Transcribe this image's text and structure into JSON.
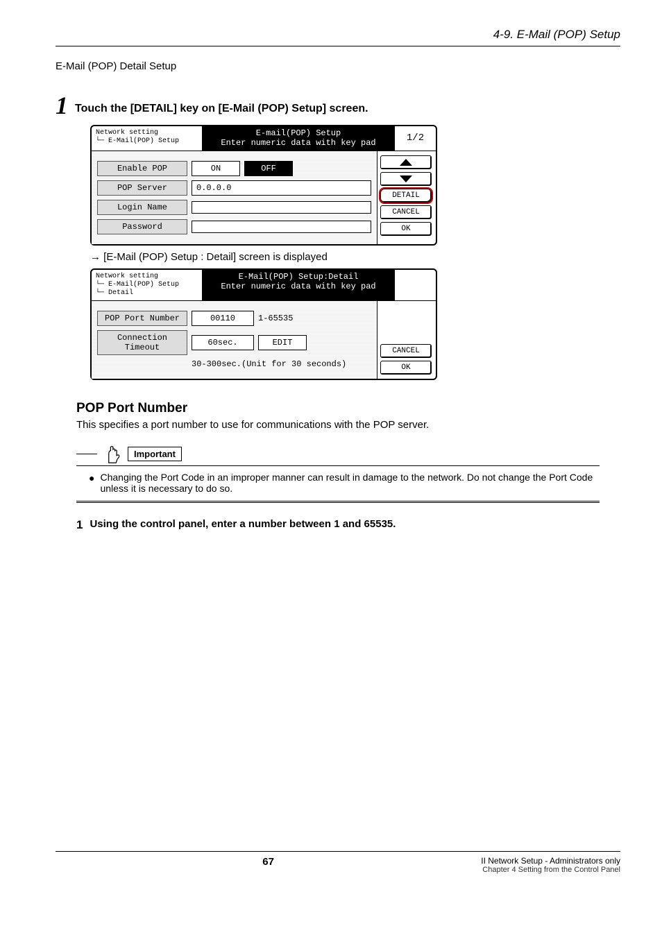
{
  "header_section": "4-9. E-Mail (POP) Setup",
  "subtitle": "E-Mail (POP) Detail Setup",
  "step1": {
    "num": "1",
    "text": "Touch the [DETAIL] key on [E-Mail (POP) Setup] screen."
  },
  "shot1": {
    "crumbs_l1": "Network setting",
    "crumbs_l2": "└─ E-Mail(POP) Setup",
    "title_l1": "E-mail(POP) Setup",
    "title_l2": "Enter numeric data with key pad",
    "page": "1/2",
    "rows": {
      "enable_label": "Enable POP",
      "enable_on": "ON",
      "enable_off": "OFF",
      "server_label": "POP Server",
      "server_value": "0.0.0.0",
      "login_label": "Login Name",
      "password_label": "Password"
    },
    "side": {
      "detail": "DETAIL",
      "cancel": "CANCEL",
      "ok": "OK"
    }
  },
  "arrow_note": "→ [E-Mail (POP) Setup : Detail] screen is displayed",
  "shot2": {
    "crumbs_l1": "Network setting",
    "crumbs_l2": "└─ E-Mail(POP) Setup",
    "crumbs_l3": "    └─ Detail",
    "title_l1": "E-Mail(POP) Setup:Detail",
    "title_l2": "Enter numeric data with key pad",
    "rows": {
      "port_label": "POP Port Number",
      "port_value": "00110",
      "port_range": "1-65535",
      "timeout_label": "Connection Timeout",
      "timeout_value": "60sec.",
      "timeout_edit": "EDIT",
      "timeout_note": "30-300sec.(Unit for 30 seconds)"
    },
    "side": {
      "cancel": "CANCEL",
      "ok": "OK"
    }
  },
  "pop_heading": "POP Port Number",
  "pop_desc": "This specifies a port number to use for communications with the POP server.",
  "important_label": "Important",
  "important_text": "Changing the Port Code in an improper manner can result in damage to the network. Do not change the Port Code unless it is necessary to do so.",
  "substep": {
    "num": "1",
    "text": "Using the control panel, enter a number between 1 and 65535."
  },
  "footer": {
    "page": "67",
    "r1": "II Network Setup - Administrators only",
    "r2": "Chapter 4 Setting from the Control Panel"
  }
}
